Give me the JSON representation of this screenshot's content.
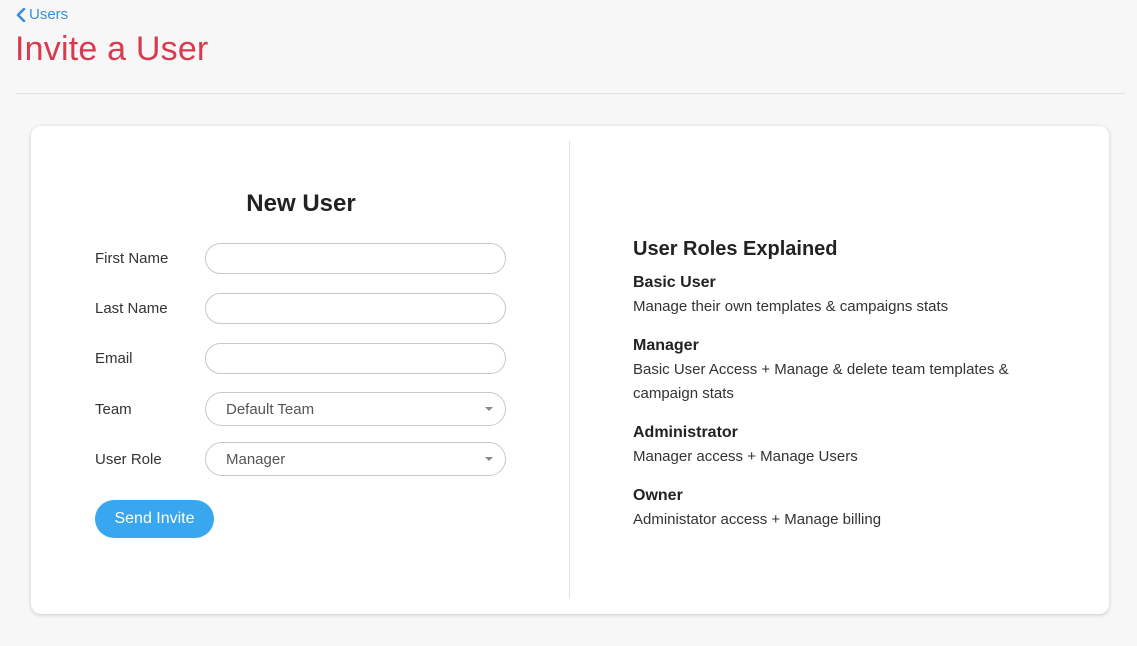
{
  "nav": {
    "back_label": "Users"
  },
  "page": {
    "title": "Invite a User"
  },
  "form": {
    "title": "New User",
    "fields": [
      {
        "label": "First Name",
        "value": ""
      },
      {
        "label": "Last Name",
        "value": ""
      },
      {
        "label": "Email",
        "value": ""
      },
      {
        "label": "Team",
        "selected": "Default Team"
      },
      {
        "label": "User Role",
        "selected": "Manager"
      }
    ],
    "submit_label": "Send Invite"
  },
  "roles": {
    "title": "User Roles Explained",
    "items": [
      {
        "name": "Basic User",
        "desc": "Manage their own templates & campaigns stats"
      },
      {
        "name": "Manager",
        "desc": "Basic User Access + Manage & delete team templates & campaign stats"
      },
      {
        "name": "Administrator",
        "desc": "Manager access + Manage Users"
      },
      {
        "name": "Owner",
        "desc": "Administator access + Manage billing"
      }
    ]
  },
  "colors": {
    "accent": "#38a7f0",
    "title": "#d93a4e",
    "link": "#3a8fd6"
  }
}
